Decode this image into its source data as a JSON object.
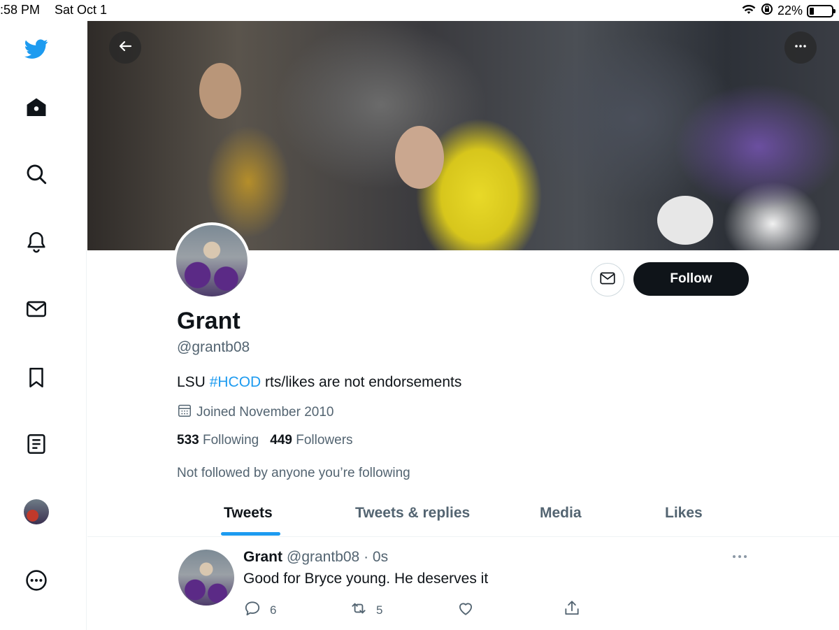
{
  "status_bar": {
    "time": ":58 PM",
    "date": "Sat Oct 1",
    "battery": "22%"
  },
  "sidebar": {
    "items": [
      {
        "name": "twitter-logo-icon"
      },
      {
        "name": "home-icon"
      },
      {
        "name": "search-icon"
      },
      {
        "name": "notifications-bell-icon"
      },
      {
        "name": "messages-envelope-icon"
      },
      {
        "name": "bookmark-icon"
      },
      {
        "name": "lists-icon"
      },
      {
        "name": "profile-avatar"
      },
      {
        "name": "more-ellipsis-icon"
      }
    ]
  },
  "profile": {
    "name": "Grant",
    "handle": "@grantb08",
    "bio_prefix": "LSU ",
    "bio_hashtag": "#HCOD",
    "bio_suffix": " rts/likes are not endorsements",
    "joined": "Joined November 2010",
    "following_count": "533",
    "following_label": "Following",
    "followers_count": "449",
    "followers_label": "Followers",
    "not_followed_text": "Not followed by anyone you’re following",
    "follow_button": "Follow"
  },
  "tabs": [
    {
      "label": "Tweets",
      "active": true
    },
    {
      "label": "Tweets & replies",
      "active": false
    },
    {
      "label": "Media",
      "active": false
    },
    {
      "label": "Likes",
      "active": false
    }
  ],
  "tweet": {
    "name": "Grant",
    "meta": "@grantb08 · 0s",
    "text": "Good for Bryce young. He deserves it",
    "replies": "6",
    "retweets": "5"
  },
  "colors": {
    "accent": "#1d9bf0",
    "text_primary": "#0f1419",
    "text_secondary": "#536471",
    "follow_button_bg": "#0f1419"
  }
}
